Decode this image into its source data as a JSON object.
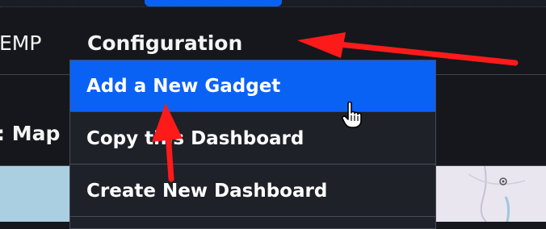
{
  "nav": {
    "partial_item": "EMP",
    "configuration": "Configuration"
  },
  "page": {
    "title_partial": ": Map"
  },
  "dropdown": {
    "items": [
      {
        "label": "Add a New Gadget"
      },
      {
        "label": "Copy this Dashboard"
      },
      {
        "label": "Create New Dashboard"
      }
    ]
  },
  "colors": {
    "accent": "#0a62f5",
    "annotation_arrow": "#ff1a1a",
    "background": "#15171d",
    "menu_background": "#1f2129"
  },
  "icons": {
    "cursor": "hand-pointer-icon"
  }
}
